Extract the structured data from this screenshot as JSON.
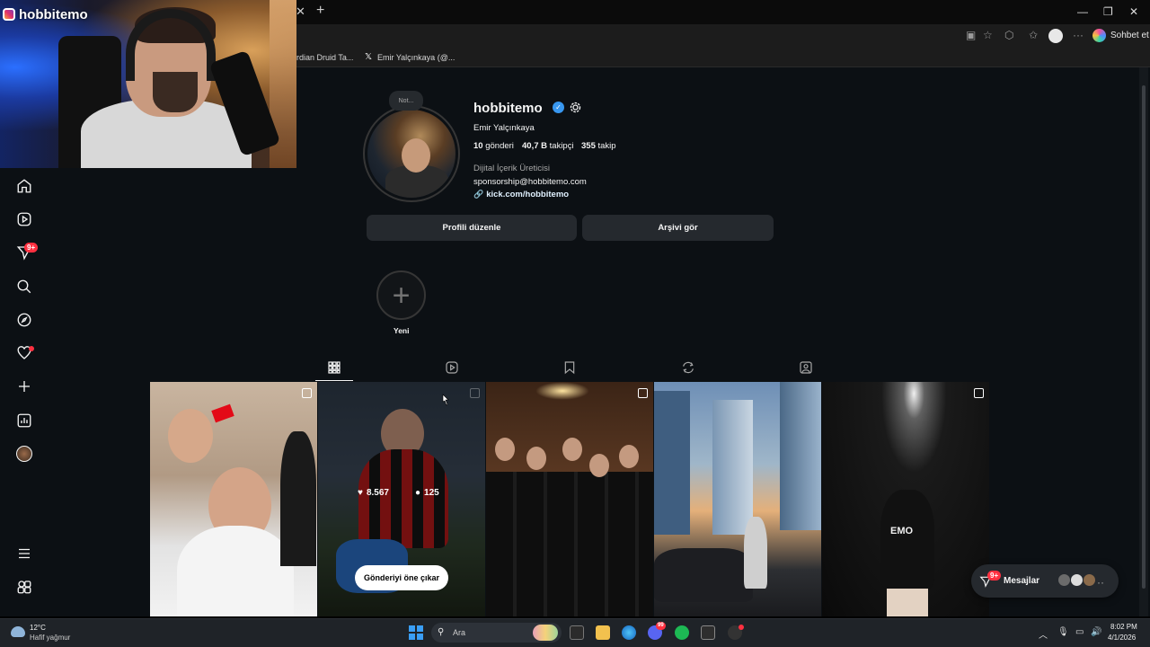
{
  "browser": {
    "bookmarks": [
      "rdian Druid Ta...",
      "Emir Yalçınkaya (@..."
    ],
    "chat_label": "Sohbet et",
    "tab_close": "✕",
    "new_tab": "+",
    "window_controls": [
      "—",
      "❐",
      "✕"
    ]
  },
  "overlay": {
    "streamer_name": "hobbitemo"
  },
  "sidebar": {
    "icons": [
      "home-icon",
      "reels-icon",
      "messages-icon",
      "search-icon",
      "explore-icon",
      "notifications-icon",
      "create-icon",
      "dashboard-icon",
      "profile-avatar",
      "more-menu-icon",
      "also-from-meta-icon"
    ],
    "messages_badge": "9+"
  },
  "profile": {
    "note_label": "Not...",
    "username": "hobbitemo",
    "full_name": "Emir Yalçınkaya",
    "stats": {
      "posts_count": "10",
      "posts_label": "gönderi",
      "followers_count": "40,7 B",
      "followers_label": "takipçi",
      "following_count": "355",
      "following_label": "takip"
    },
    "category": "Dijital İçerik Üreticisi",
    "email": "sponsorship@hobbitemo.com",
    "link": "kick.com/hobbitemo",
    "edit_button": "Profili düzenle",
    "archive_button": "Arşivi gör",
    "highlight_new_label": "Yeni"
  },
  "tabs": [
    "posts-grid-icon",
    "reels-tab-icon",
    "saved-tab-icon",
    "reposts-tab-icon",
    "tagged-tab-icon"
  ],
  "grid": {
    "hover_likes": "8.567",
    "hover_comments": "125",
    "pin_button": "Gönderiyi öne çıkar",
    "overlay_text": "EMO"
  },
  "floating": {
    "messages_label": "Mesajlar",
    "messages_badge": "9+"
  },
  "taskbar": {
    "temperature": "12°C",
    "weather": "Hafif yağmur",
    "search_placeholder": "Ara",
    "time": "8:02 PM",
    "date": "4/1/2026"
  },
  "colors": {
    "page_bg": "#0c1014",
    "button_bg": "#25292e",
    "badge_red": "#ff3040",
    "verified_blue": "#3897f0"
  }
}
